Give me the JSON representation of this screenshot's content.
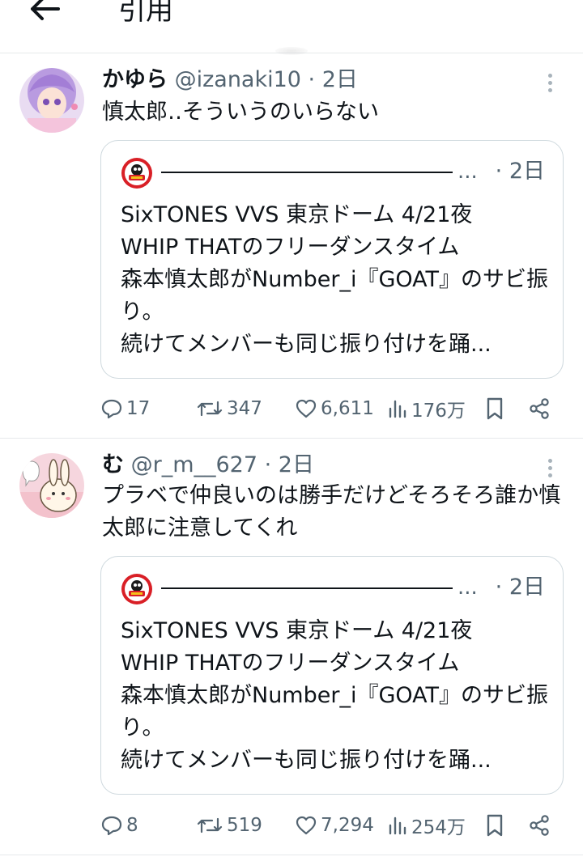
{
  "header": {
    "title": "引用"
  },
  "tweets": [
    {
      "display_name": "かゆら",
      "handle": "@izanaki10",
      "separator": " · ",
      "time": "2日",
      "text": "慎太郎‥そういうのいらない",
      "quote": {
        "author_line": "—————————————————",
        "ellipsis": "...",
        "time": "· 2日",
        "text": "SixTONES VVS 東京ドーム 4/21夜\nWHIP THATのフリーダンスタイム\n森本慎太郎がNumber_i『GOAT』のサビ振り。\n続けてメンバーも同じ振り付けを踊..."
      },
      "stats": {
        "replies": "17",
        "reposts": "347",
        "likes": "6,611",
        "views": "176万"
      }
    },
    {
      "display_name": "む",
      "handle": "@r_m__627",
      "separator": " · ",
      "time": "2日",
      "text": "プラベで仲良いのは勝手だけどそろそろ誰か慎太郎に注意してくれ",
      "quote": {
        "author_line": "—————————————————",
        "ellipsis": "...",
        "time": "· 2日",
        "text": "SixTONES VVS 東京ドーム 4/21夜\nWHIP THATのフリーダンスタイム\n森本慎太郎がNumber_i『GOAT』のサビ振り。\n続けてメンバーも同じ振り付けを踊..."
      },
      "stats": {
        "replies": "8",
        "reposts": "519",
        "likes": "7,294",
        "views": "254万"
      }
    }
  ],
  "icons": {
    "back": "back-arrow-icon",
    "more": "more-vertical-icon",
    "reply": "reply-icon",
    "repost": "repost-icon",
    "like": "heart-icon",
    "views": "views-bar-chart-icon",
    "bookmark": "bookmark-icon",
    "share": "share-icon"
  },
  "colors": {
    "text": "#0f1419",
    "secondary": "#536471",
    "border": "#cfd9de",
    "divider": "#e6e9eb"
  }
}
